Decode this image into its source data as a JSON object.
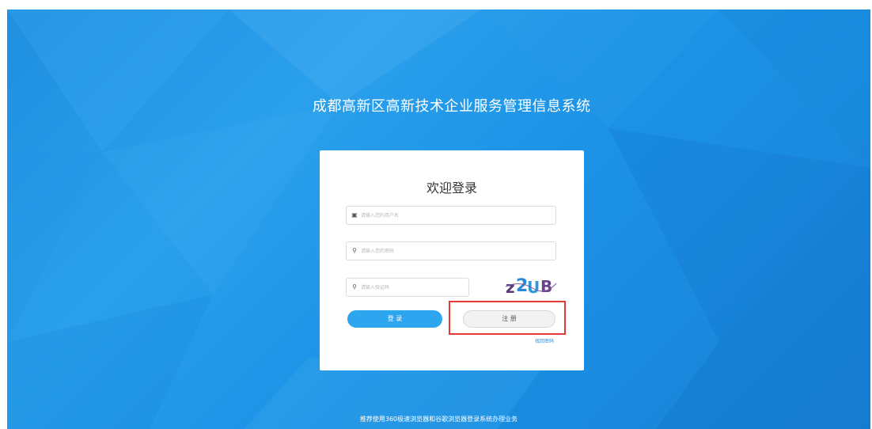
{
  "system_title": "成都高新区高新技术企业服务管理信息系统",
  "login": {
    "heading": "欢迎登录",
    "username_placeholder": "请输入您的用户名",
    "password_placeholder": "请输入您的密码",
    "captcha_placeholder": "请输入验证码",
    "captcha_text": "z2UB",
    "login_label": "登 录",
    "register_label": "注 册",
    "forgot_label": "找回密码"
  },
  "footer_note": "推荐使用360极速浏览器和谷歌浏览器登录系统办理业务",
  "icons": {
    "username": "user-icon",
    "password": "key-icon",
    "captcha": "key-icon"
  },
  "colors": {
    "background": "#1f8fe0",
    "primary_button": "#2ea6ef",
    "highlight": "#e53935",
    "link": "#2d8fe2"
  }
}
